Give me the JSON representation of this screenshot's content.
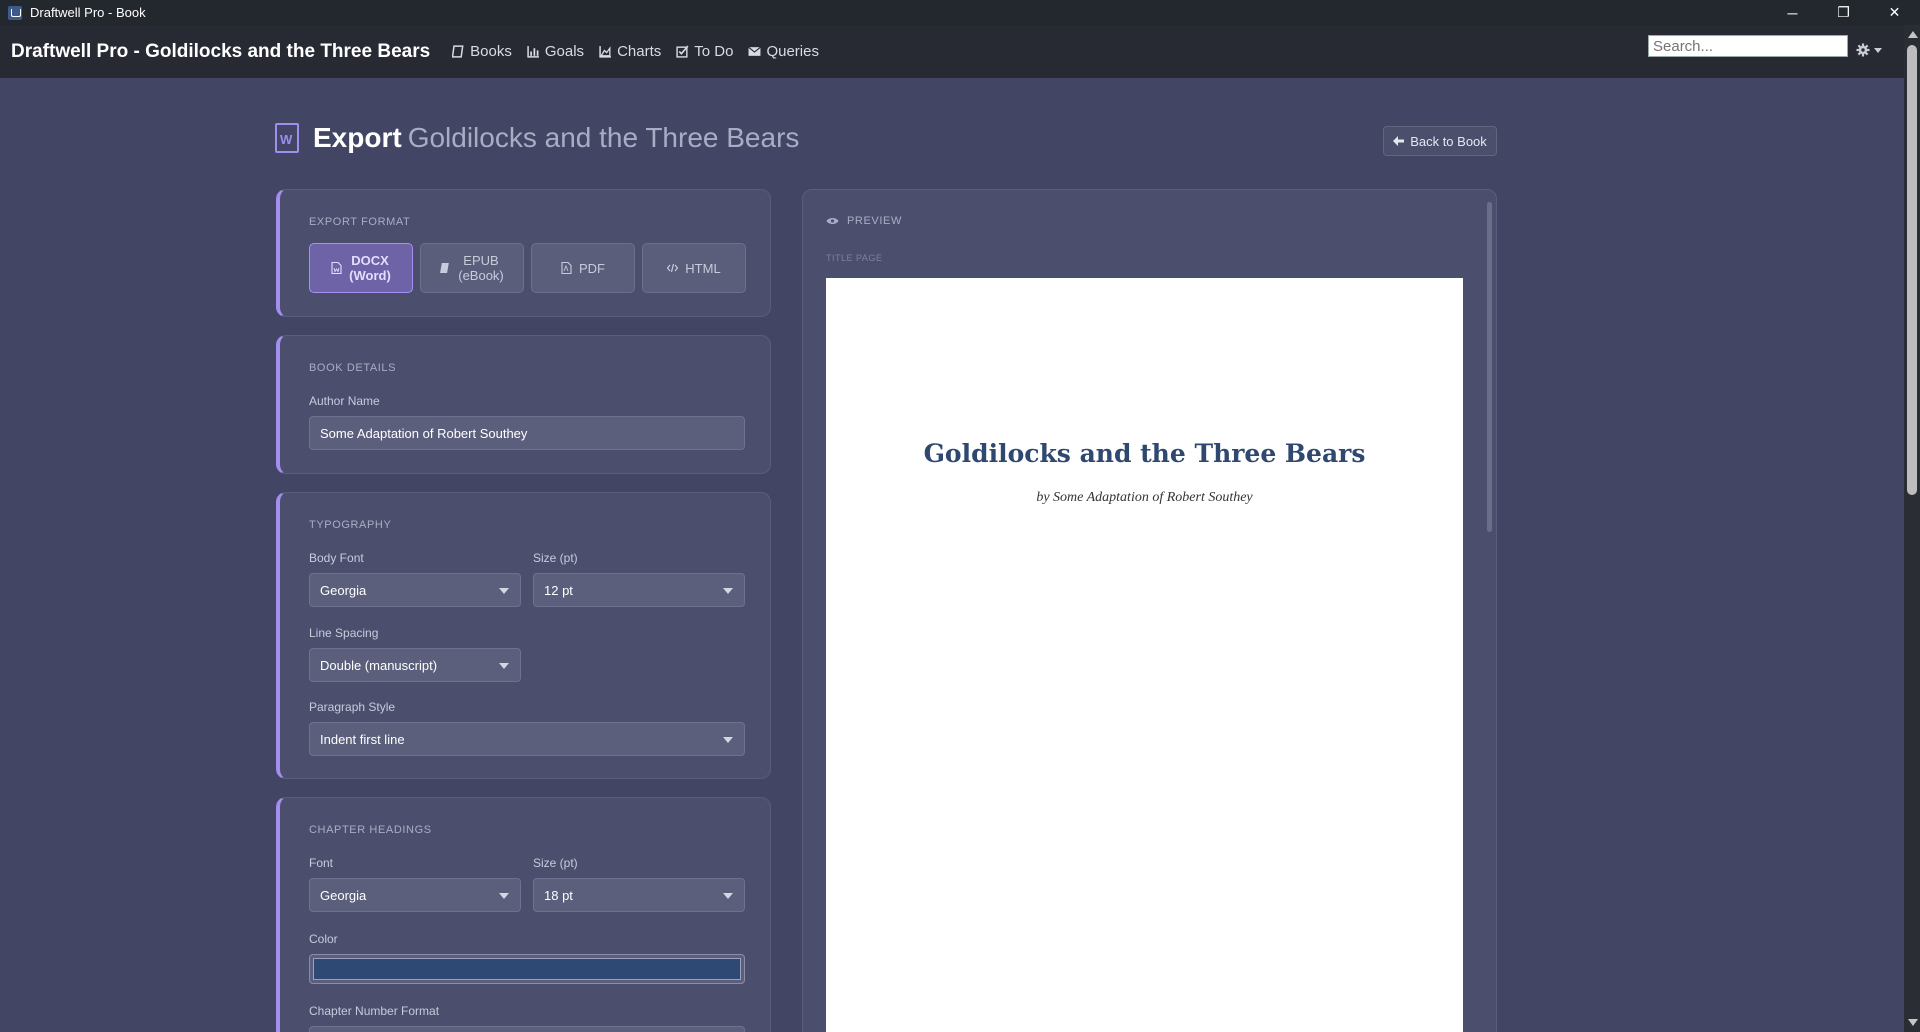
{
  "os": {
    "title": "Draftwell Pro - Book",
    "minimize": "─",
    "restore": "❐",
    "close": "✕"
  },
  "navbar": {
    "brand": "Draftwell Pro - Goldilocks and the Three Bears",
    "links": [
      {
        "label": "Books",
        "icon": "book-icon"
      },
      {
        "label": "Goals",
        "icon": "bar-chart-icon"
      },
      {
        "label": "Charts",
        "icon": "area-chart-icon"
      },
      {
        "label": "To Do",
        "icon": "checkbox-icon"
      },
      {
        "label": "Queries",
        "icon": "envelope-icon"
      }
    ],
    "search_placeholder": "Search..."
  },
  "header": {
    "title_strong": "Export",
    "title_book": "Goldilocks and the Three Bears",
    "back_label": "Back to Book"
  },
  "export_format": {
    "title": "Export Format",
    "options": [
      {
        "line1": "DOCX",
        "line2": "(Word)",
        "active": true,
        "icon": "file-word-icon"
      },
      {
        "line1": "EPUB",
        "line2": "(eBook)",
        "active": false,
        "icon": "book-icon"
      },
      {
        "line1": "PDF",
        "line2": "",
        "active": false,
        "icon": "file-pdf-icon"
      },
      {
        "line1": "HTML",
        "line2": "",
        "active": false,
        "icon": "code-icon"
      }
    ]
  },
  "book_details": {
    "title": "Book Details",
    "author_label": "Author Name",
    "author_value": "Some Adaptation of Robert Southey"
  },
  "typography": {
    "title": "Typography",
    "body_font_label": "Body Font",
    "body_font_value": "Georgia",
    "size_label": "Size (pt)",
    "size_value": "12 pt",
    "line_spacing_label": "Line Spacing",
    "line_spacing_value": "Double (manuscript)",
    "paragraph_label": "Paragraph Style",
    "paragraph_value": "Indent first line"
  },
  "chapter_headings": {
    "title": "Chapter Headings",
    "font_label": "Font",
    "font_value": "Georgia",
    "size_label": "Size (pt)",
    "size_value": "18 pt",
    "color_label": "Color",
    "color_value": "#2e4a74",
    "number_format_label": "Chapter Number Format"
  },
  "preview": {
    "title": "Preview",
    "subtitle": "TITLE PAGE",
    "book_title": "Goldilocks and the Three Bears",
    "byline": "by Some Adaptation of Robert Southey"
  },
  "colors": {
    "accent": "#a48ff0",
    "background": "#424563",
    "navbar": "#272a33"
  }
}
